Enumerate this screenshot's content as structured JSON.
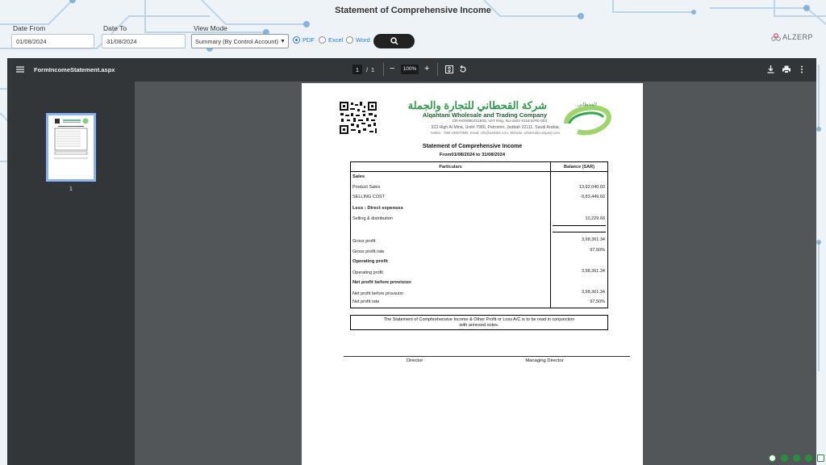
{
  "app": {
    "title": "Statement of Comprehensive Income"
  },
  "filters": {
    "date_from_label": "Date From",
    "date_from_value": "01/08/2024",
    "date_to_label": "Date To",
    "date_to_value": "31/08/2024",
    "view_mode_label": "View Mode",
    "view_mode_value": "Summary (By Control Account)",
    "formats": [
      {
        "label": "PDF",
        "selected": true
      },
      {
        "label": "Excel",
        "selected": false
      },
      {
        "label": "Word",
        "selected": false
      }
    ],
    "search_icon": "search-icon"
  },
  "brand": {
    "logo_text": "ALZERP"
  },
  "viewer": {
    "filename": "FormIncomeStatement.aspx",
    "page_current": "1",
    "page_sep": "/",
    "page_total": "1",
    "zoom": "100%",
    "thumb_label": "1"
  },
  "report": {
    "company_arabic": "شركة القحطاني للتجارة والجملة",
    "company_name": "Alqahtani Wholesale and Trading Company",
    "company_reg": "CR-NO5890311845, VAT Reg. No-3102 6116 5700 003",
    "company_address": "323 High Al Mina, Unit# 7980, Petromin, Jeddah 22111, Saudi Arabia.",
    "company_contact": "Hotline: +966 538670886, Email: info@website.com, Website: wholesalecompany.com",
    "logo_arabic": "القحطاني",
    "logo_text": "AWTC",
    "title": "Statement of Comprehensive Income",
    "period": "From01/08/2024 to 31/08/2024",
    "col_particulars": "Particulars",
    "col_balance": "Balance (SAR)",
    "rows": {
      "sales_head": "Sales",
      "product_sales": "Product Sales",
      "product_sales_val": "13,92,040.60",
      "selling_cost": "SELLING COST",
      "selling_cost_val": "-9,83,449.60",
      "direct_head": "Less : Direct expenses",
      "selling_dist": "Selling & distribution",
      "selling_dist_val": "10,229.66",
      "gross_profit": "Gross profit",
      "gross_profit_val": "3,98,361.34",
      "gross_rate": "Gross profit rate",
      "gross_rate_val": "97.50%",
      "op_head": "Operating profit",
      "op_profit": "Operating profit",
      "op_profit_val": "3,98,361.34",
      "np_head": "Net profit before provision",
      "np_before": "Net profit before provision",
      "np_before_val": "3,98,361.34",
      "np_rate": "Net profit rate",
      "np_rate_val": "97.50%"
    },
    "note": "The Statement of Comphrehensive Income & Other Profit or Loss A/C is to be read in conjunction with annexed notes.",
    "sign_director": "Director",
    "sign_md": "Managing Director"
  }
}
